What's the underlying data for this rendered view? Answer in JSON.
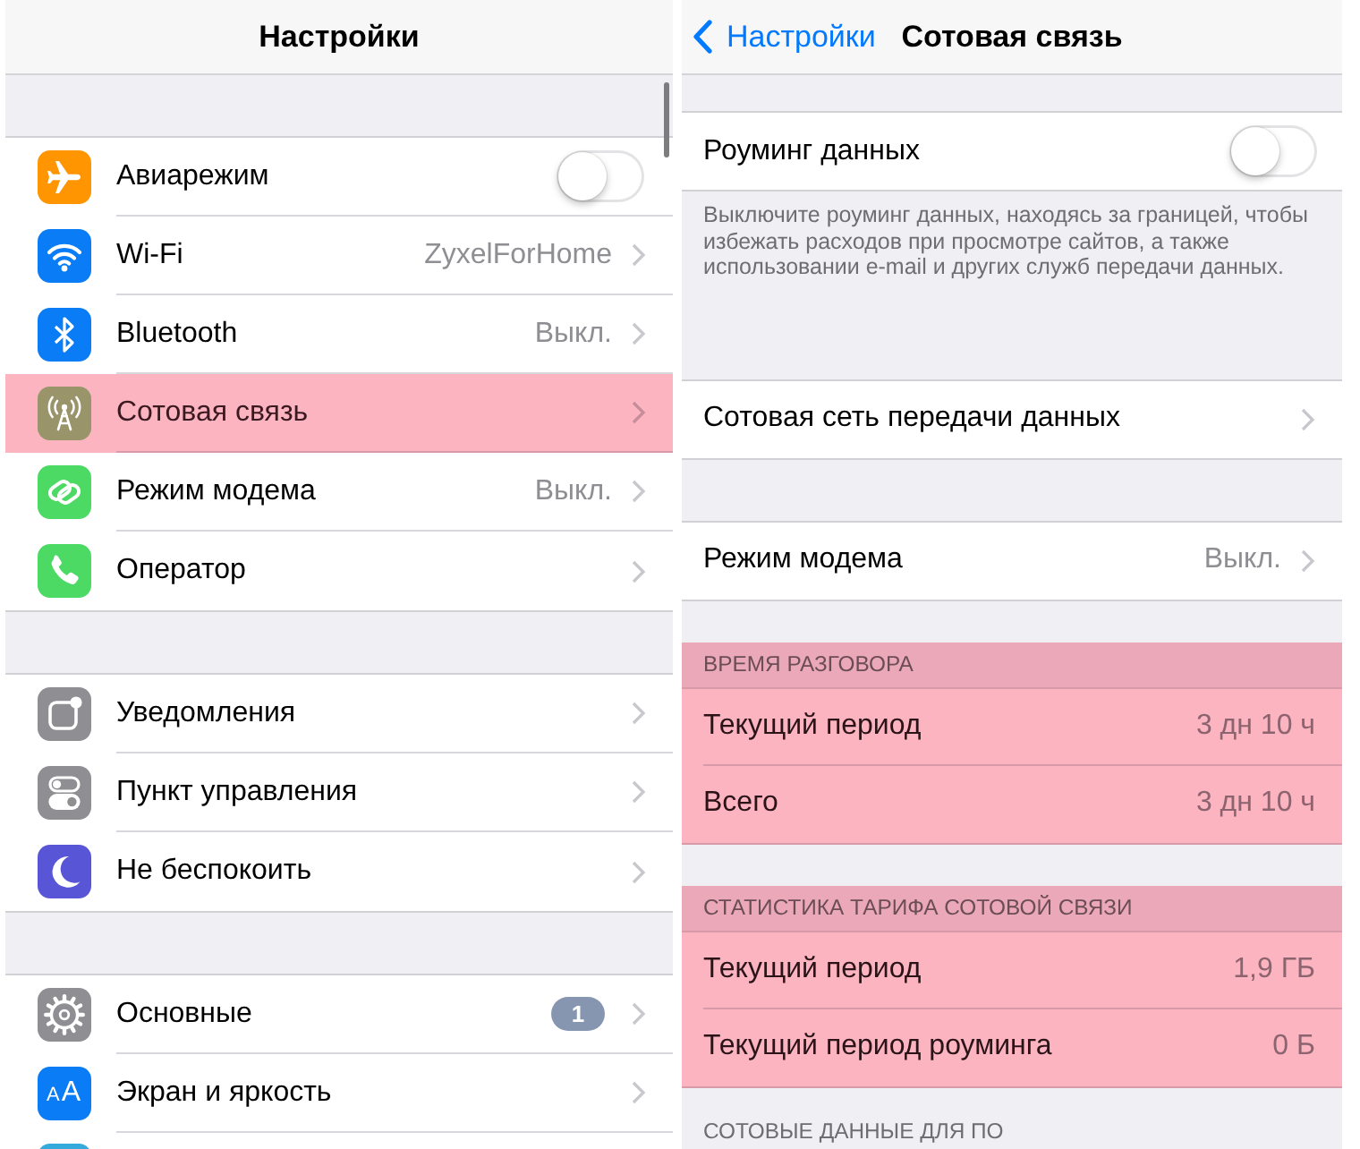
{
  "settings": {
    "title": "Настройки",
    "groups": [
      {
        "items": [
          {
            "kind": "toggle",
            "label": "Авиарежим",
            "on": false,
            "highlighted": false
          },
          {
            "kind": "link",
            "label": "Wi-Fi",
            "value": "ZyxelForHome",
            "highlighted": false
          },
          {
            "kind": "link",
            "label": "Bluetooth",
            "value": "Выкл.",
            "highlighted": false
          },
          {
            "kind": "link",
            "label": "Сотовая связь",
            "highlighted": true
          },
          {
            "kind": "link",
            "label": "Режим модема",
            "value": "Выкл.",
            "highlighted": false
          },
          {
            "kind": "link",
            "label": "Оператор",
            "highlighted": false
          }
        ]
      },
      {
        "items": [
          {
            "kind": "link",
            "label": "Уведомления",
            "highlighted": false
          },
          {
            "kind": "link",
            "label": "Пункт управления",
            "highlighted": false
          },
          {
            "kind": "link",
            "label": "Не беспокоить",
            "highlighted": false
          }
        ]
      },
      {
        "items": [
          {
            "kind": "link",
            "label": "Основные",
            "badge": "1",
            "highlighted": false
          },
          {
            "kind": "link",
            "icon_text": "AA",
            "label": "Экран и яркость",
            "highlighted": false
          },
          {
            "kind": "cut_off",
            "highlighted": false
          }
        ]
      }
    ]
  },
  "cellular": {
    "back": "Настройки",
    "title": "Сотовая связь",
    "groups": [
      {
        "highlighted": false,
        "items": [
          {
            "kind": "toggle",
            "label": "Роуминг данных",
            "on": false
          }
        ],
        "footer": "Выключите роуминг данных, находясь за границей, чтобы избежать расходов при просмотре сайтов, а также использовании e-mail и других служб передачи данных."
      },
      {
        "highlighted": false,
        "items": [
          {
            "kind": "link",
            "label": "Сотовая сеть передачи данных"
          }
        ]
      },
      {
        "highlighted": false,
        "items": [
          {
            "kind": "link",
            "label": "Режим модема",
            "value": "Выкл."
          }
        ]
      },
      {
        "highlighted": true,
        "header": "ВРЕМЯ РАЗГОВОРА",
        "items": [
          {
            "kind": "stat",
            "label": "Текущий период",
            "value": "3 дн 10 ч"
          },
          {
            "kind": "stat",
            "label": "Всего",
            "value": "3 дн 10 ч"
          }
        ]
      },
      {
        "highlighted": true,
        "header": "СТАТИСТИКА ТАРИФА СОТОВОЙ СВЯЗИ",
        "items": [
          {
            "kind": "stat",
            "label": "Текущий период",
            "value": "1,9 ГБ"
          },
          {
            "kind": "stat",
            "label": "Текущий период роуминга",
            "value": "0 Б"
          }
        ]
      },
      {
        "highlighted": false,
        "header": "СОТОВЫЕ ДАННЫЕ ДЛЯ ПО"
      }
    ]
  }
}
